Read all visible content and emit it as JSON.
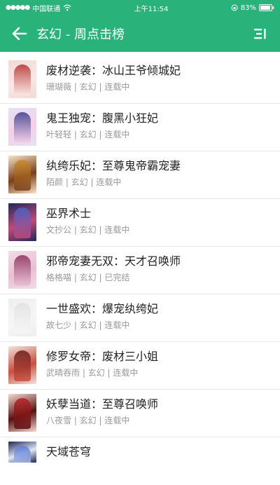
{
  "status_bar": {
    "carrier": "中国联通",
    "time": "上午11:54",
    "battery": "83%"
  },
  "nav": {
    "title": "玄幻 - 周点击榜",
    "back_icon": "arrow-left-icon",
    "more_icon": "list-menu-icon"
  },
  "colors": {
    "header": "#2ab27b",
    "title_text": "#222222",
    "meta_text": "#999999"
  },
  "books": [
    {
      "title": "废材逆袭：冰山王爷倾城妃",
      "meta": "珊瑚薇 | 玄幻 | 连载中",
      "cover": [
        "#f1d9d6",
        "#b3312f",
        "#fce7e4"
      ]
    },
    {
      "title": "鬼王独宠：腹黑小狂妃",
      "meta": "叶轻轻 | 玄幻 | 连载中",
      "cover": [
        "#e4e2f4",
        "#3d3b8c",
        "#f4d0e8"
      ]
    },
    {
      "title": "纨绔乐妃：至尊鬼帝霸宠妻",
      "meta": "陌颜 | 玄幻 | 连载中",
      "cover": [
        "#f6e4c6",
        "#c98b2c",
        "#7a3e1a"
      ]
    },
    {
      "title": "巫界术士",
      "meta": "文抄公 | 玄幻 | 连载中",
      "cover": [
        "#1d2a5a",
        "#4a63c9",
        "#c04a7a"
      ]
    },
    {
      "title": "邪帝宠妻无双：天才召唤师",
      "meta": "格格喵 | 玄幻 | 已完结",
      "cover": [
        "#f3dbe6",
        "#8c2f5a",
        "#e8c0d4"
      ]
    },
    {
      "title": "一世盛欢：爆宠纨绔妃",
      "meta": "故七少 | 玄幻 | 连载中",
      "cover": [
        "#eeeeee",
        "#e2e2e2",
        "#f6f6f6"
      ]
    },
    {
      "title": "修罗女帝：废材三小姐",
      "meta": "武晴吞雨 | 玄幻 | 连载中",
      "cover": [
        "#f2e2dc",
        "#6b1b1b",
        "#c94f3f"
      ]
    },
    {
      "title": "妖孽当道：至尊召唤师",
      "meta": "八夜雪 | 玄幻 | 连载中",
      "cover": [
        "#f4d8d0",
        "#b22222",
        "#5a1010"
      ]
    },
    {
      "title": "天域苍穹",
      "meta": "",
      "cover": [
        "#1c2850",
        "#5a7bd6",
        "#e0e6f6"
      ]
    }
  ]
}
